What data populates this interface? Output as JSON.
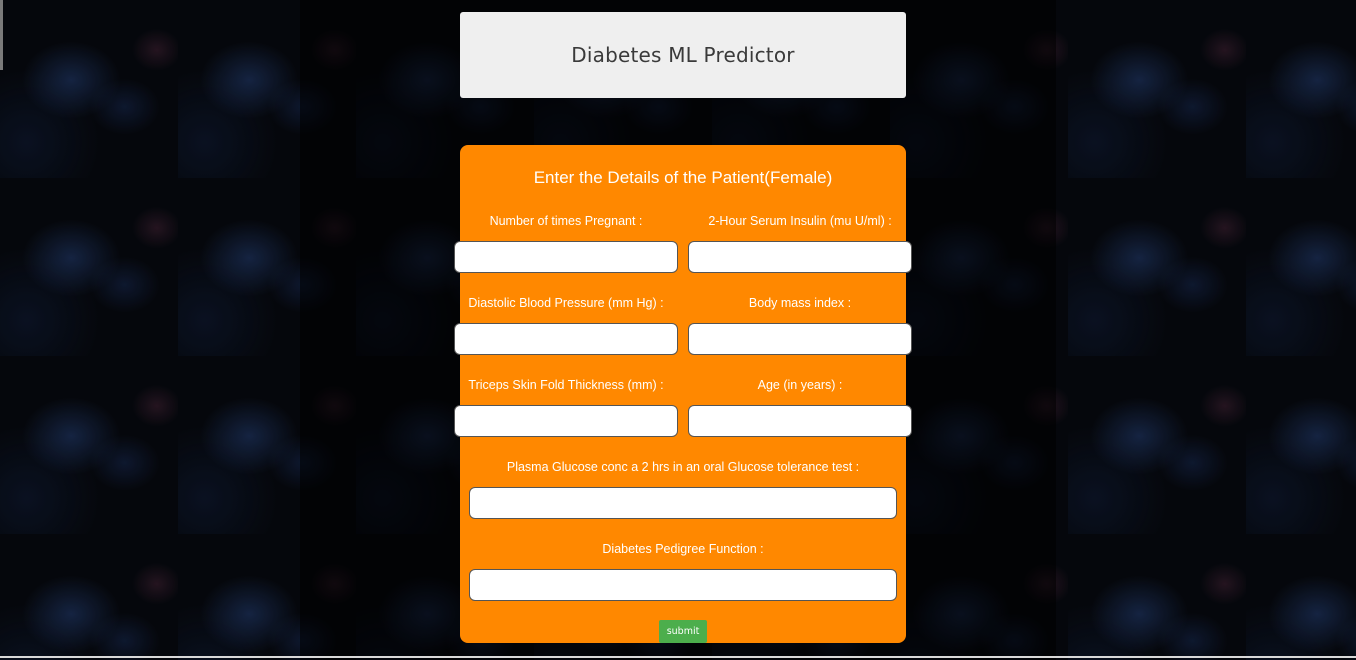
{
  "header": {
    "title": "Diabetes ML Predictor"
  },
  "form": {
    "title": "Enter the Details of the Patient(Female)",
    "fields": {
      "pregnancies": {
        "label": "Number of times Pregnant :",
        "value": ""
      },
      "insulin": {
        "label": "2-Hour Serum Insulin (mu U/ml) :",
        "value": ""
      },
      "blood_pressure": {
        "label": "Diastolic Blood Pressure (mm Hg) :",
        "value": ""
      },
      "bmi": {
        "label": "Body mass index :",
        "value": ""
      },
      "skin_thickness": {
        "label": "Triceps Skin Fold Thickness (mm) :",
        "value": ""
      },
      "age": {
        "label": "Age (in years) :",
        "value": ""
      },
      "glucose": {
        "label": "Plasma Glucose conc a 2 hrs in an oral Glucose tolerance test :",
        "value": ""
      },
      "pedigree": {
        "label": "Diabetes Pedigree Function :",
        "value": ""
      }
    },
    "submit_label": "submit"
  },
  "colors": {
    "form_background": "#ff8800",
    "header_background": "#efefef",
    "submit_background": "#4cae4c"
  }
}
